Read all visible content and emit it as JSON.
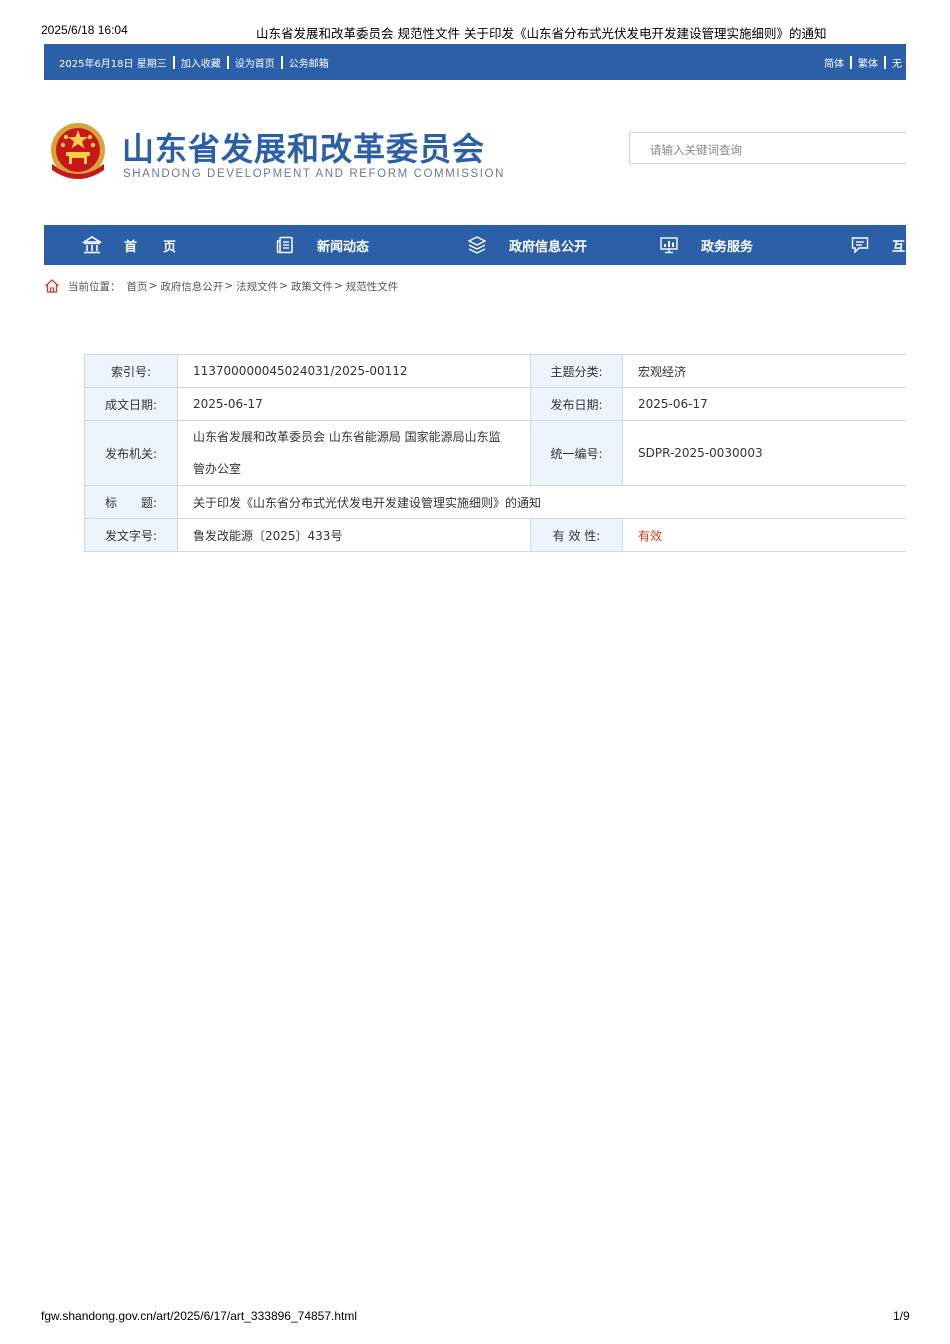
{
  "print_header": {
    "datetime": "2025/6/18 16:04",
    "page_title": "山东省发展和改革委员会 规范性文件 关于印发《山东省分布式光伏发电开发建设管理实施细则》的通知"
  },
  "topbar": {
    "date": "2025年6月18日 星期三",
    "links": [
      "加入收藏",
      "设为首页",
      "公务邮箱"
    ],
    "right_links": [
      "简体",
      "繁体",
      "无"
    ]
  },
  "logo": {
    "title": "山东省发展和改革委员会",
    "subtitle": "SHANDONG DEVELOPMENT AND REFORM COMMISSION"
  },
  "search": {
    "placeholder": "请输入关键词查询"
  },
  "nav": {
    "items": [
      {
        "label": "首　　页",
        "icon": "bank-icon"
      },
      {
        "label": "新闻动态",
        "icon": "newspaper-icon"
      },
      {
        "label": "政府信息公开",
        "icon": "layers-icon"
      },
      {
        "label": "政务服务",
        "icon": "monitor-chart-icon"
      },
      {
        "label": "互",
        "icon": "chat-icon"
      }
    ]
  },
  "breadcrumb": {
    "label": "当前位置：",
    "items": [
      "首页",
      "政府信息公开",
      "法规文件",
      "政策文件",
      "规范性文件"
    ]
  },
  "info_table": {
    "index_no_label": "索引号:",
    "index_no": "113700000045024031/2025-00112",
    "topic_label": "主题分类:",
    "topic": "宏观经济",
    "written_date_label": "成文日期:",
    "written_date": "2025-06-17",
    "publish_date_label": "发布日期:",
    "publish_date": "2025-06-17",
    "issuer_label": "发布机关:",
    "issuer_line1": "山东省发展和改革委员会 山东省能源局 国家能源局山东监",
    "issuer_line2": "管办公室",
    "unified_no_label": "统一编号:",
    "unified_no": "SDPR-2025-0030003",
    "title_label": "标　　题:",
    "title": "关于印发《山东省分布式光伏发电开发建设管理实施细则》的通知",
    "doc_no_label": "发文字号:",
    "doc_no": "鲁发改能源〔2025〕433号",
    "validity_label": "有 效 性:",
    "validity": "有效"
  },
  "print_footer": {
    "url": "fgw.shandong.gov.cn/art/2025/6/17/art_333896_74857.html",
    "page": "1/9"
  },
  "colors": {
    "brand_blue": "#2b5fa8",
    "table_label_bg": "#eef4fc",
    "valid_red": "#d9381e"
  }
}
